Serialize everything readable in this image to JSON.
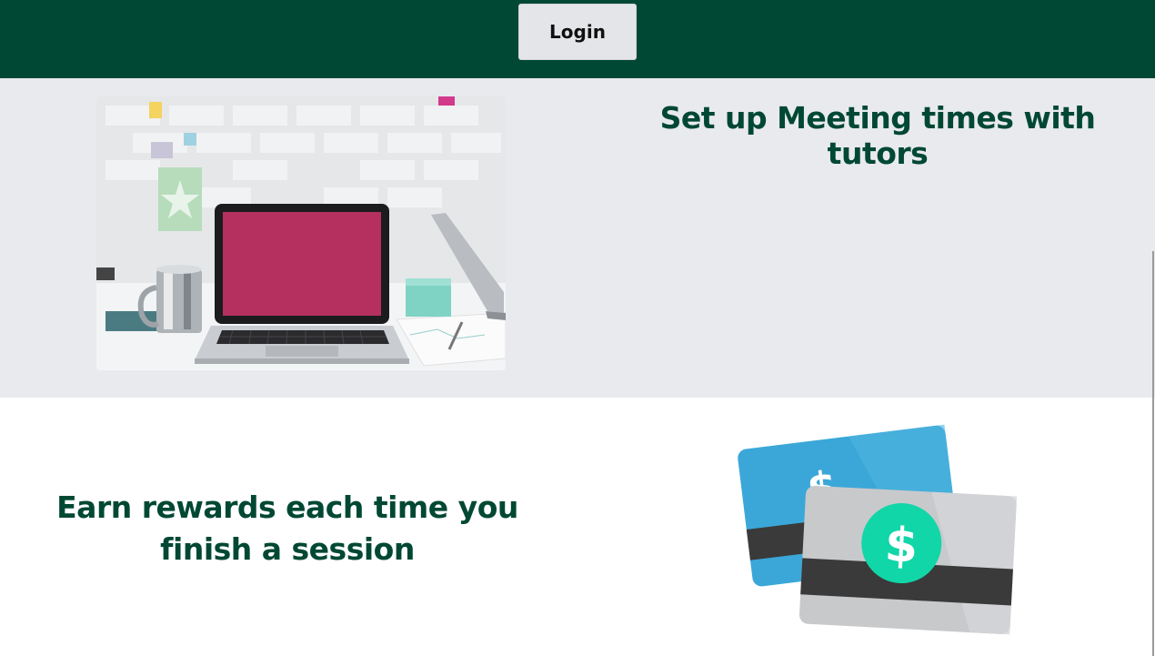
{
  "header": {
    "login_label": "Login"
  },
  "features": [
    {
      "title": "Set up Meeting times with tutors"
    },
    {
      "title": "Earn rewards each time you finish a session"
    }
  ],
  "colors": {
    "brand_green": "#004833",
    "section_gray": "#e9eaed",
    "laptop_screen": "#b5305f",
    "card_blue": "#3ba7d8",
    "dollar_badge": "#11d6a8"
  },
  "icons": {
    "dollar_symbol": "$"
  }
}
